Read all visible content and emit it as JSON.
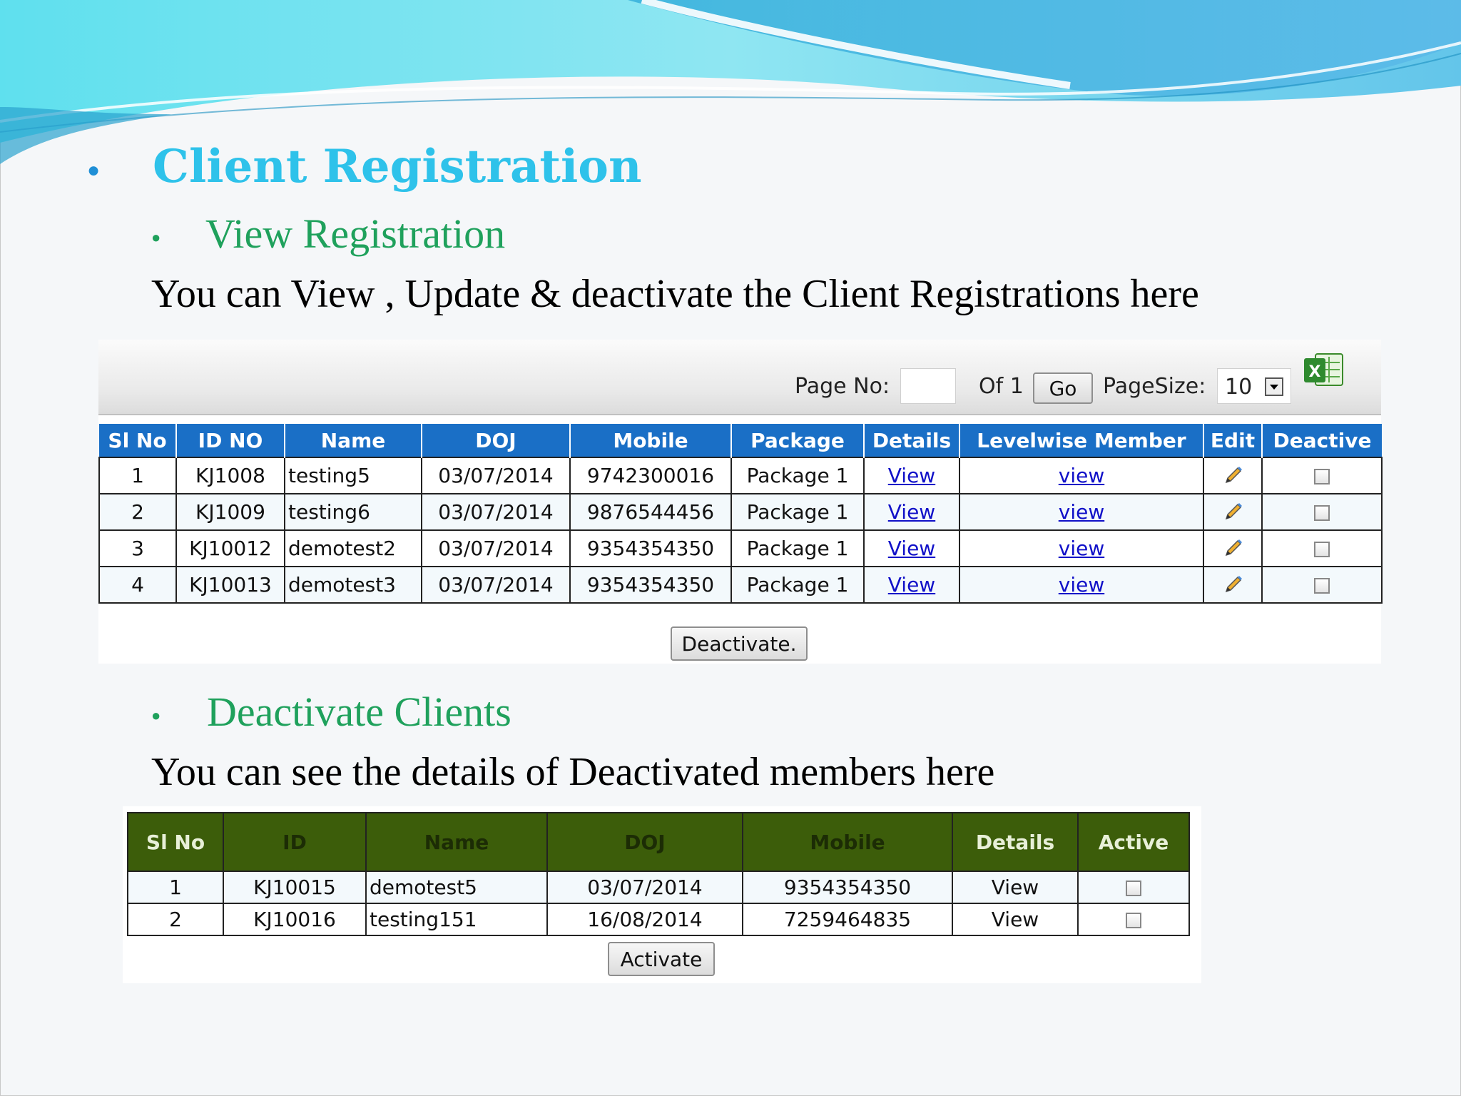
{
  "heading": {
    "title": "Client Registration"
  },
  "section1": {
    "title": "View Registration",
    "description": "You can View , Update & deactivate the Client Registrations here"
  },
  "pager": {
    "page_no_label": "Page No:",
    "page_no_value": "",
    "of_label": "Of 1",
    "go_label": "Go",
    "pagesize_label": "PageSize:",
    "pagesize_value": "10"
  },
  "registrations": {
    "headers": [
      "Sl No",
      "ID NO",
      "Name",
      "DOJ",
      "Mobile",
      "Package",
      "Details",
      "Levelwise Member",
      "Edit",
      "Deactive"
    ],
    "rows": [
      {
        "sl": "1",
        "id": "KJ1008",
        "name": "testing5",
        "doj": "03/07/2014",
        "mobile": "9742300016",
        "package": "Package 1",
        "details": "View",
        "levelwise": "view"
      },
      {
        "sl": "2",
        "id": "KJ1009",
        "name": "testing6",
        "doj": "03/07/2014",
        "mobile": "9876544456",
        "package": "Package 1",
        "details": "View",
        "levelwise": "view"
      },
      {
        "sl": "3",
        "id": "KJ10012",
        "name": "demotest2",
        "doj": "03/07/2014",
        "mobile": "9354354350",
        "package": "Package 1",
        "details": "View",
        "levelwise": "view"
      },
      {
        "sl": "4",
        "id": "KJ10013",
        "name": "demotest3",
        "doj": "03/07/2014",
        "mobile": "9354354350",
        "package": "Package 1",
        "details": "View",
        "levelwise": "view"
      }
    ],
    "deactivate_button": "Deactivate."
  },
  "section2": {
    "title": "Deactivate Clients",
    "description": "You can see the details of Deactivated members here"
  },
  "deactivated": {
    "headers": [
      "Sl No",
      "ID",
      "Name",
      "DOJ",
      "Mobile",
      "Details",
      "Active"
    ],
    "rows": [
      {
        "sl": "1",
        "id": "KJ10015",
        "name": "demotest5",
        "doj": "03/07/2014",
        "mobile": "9354354350",
        "details": "View"
      },
      {
        "sl": "2",
        "id": "KJ10016",
        "name": "testing151",
        "doj": "16/08/2014",
        "mobile": "7259464835",
        "details": "View"
      }
    ],
    "activate_button": "Activate"
  },
  "icons": [
    "excel-export-icon",
    "edit-pencil-icon",
    "checkbox"
  ],
  "colors": {
    "heading": "#2ec2ea",
    "subheading": "#1fa15c",
    "table1_header": "#1a6fc6",
    "table2_header": "#3c5d0a",
    "link": "#1010c8"
  }
}
